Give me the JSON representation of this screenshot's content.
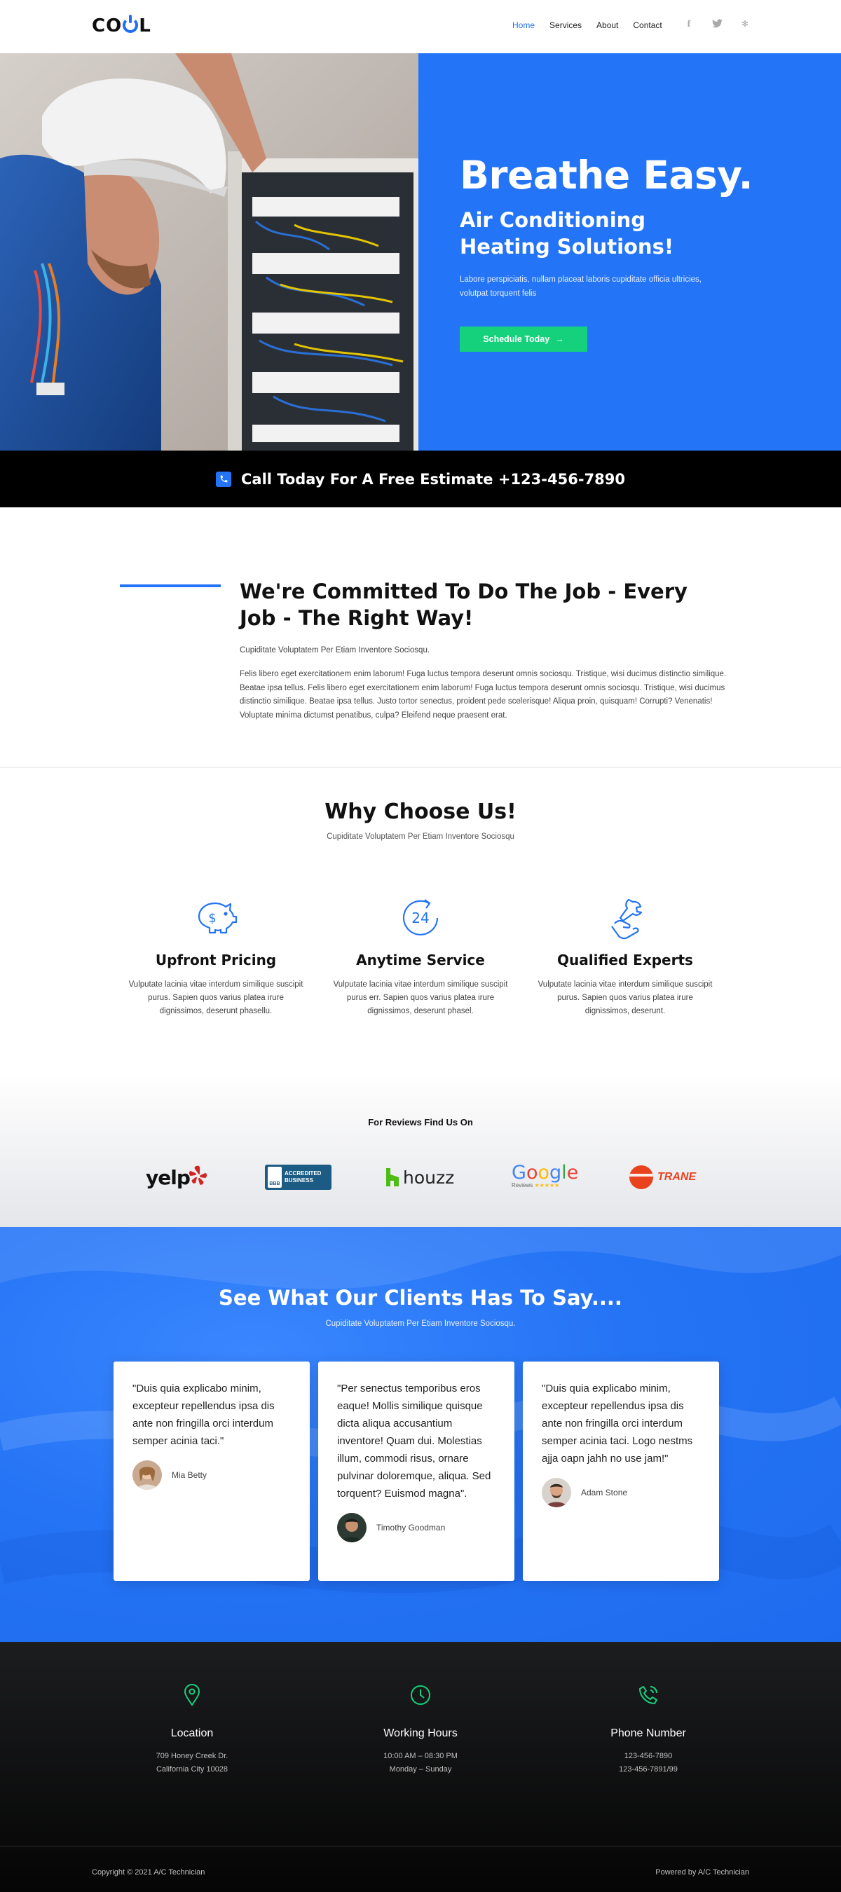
{
  "header": {
    "logo_text_left": "CO",
    "logo_text_right": "L",
    "nav": [
      {
        "label": "Home",
        "active": true
      },
      {
        "label": "Services"
      },
      {
        "label": "About"
      },
      {
        "label": "Contact"
      }
    ],
    "social": [
      "f",
      "t",
      "y"
    ]
  },
  "hero": {
    "title": "Breathe Easy.",
    "subtitle": "Air Conditioning Heating Solutions!",
    "description": "Labore perspiciatis, nullam placeat laboris cupiditate officia ultricies, volutpat torquent felis",
    "button_label": "Schedule Today",
    "background_color": "#2374f7",
    "button_color": "#16d17b"
  },
  "callbar": {
    "text": "Call Today For A Free Estimate +123-456-7890"
  },
  "commitment": {
    "title": "We're Committed To Do The Job - Every Job - The Right Way!",
    "subtitle": "Cupiditate Voluptatem Per Etiam Inventore Sociosqu.",
    "body": "Felis libero eget exercitationem enim laborum! Fuga luctus tempora deserunt omnis sociosqu. Tristique, wisi ducimus distinctio similique. Beatae ipsa tellus. Felis libero eget exercitationem enim laborum! Fuga luctus tempora deserunt omnis sociosqu. Tristique, wisi ducimus distinctio similique. Beatae ipsa tellus. Justo tortor senectus, proident pede scelerisque! Aliqua proin, quisquam! Corrupti? Venenatis! Voluptate minima dictumst penatibus, culpa? Eleifend neque praesent erat."
  },
  "why": {
    "title": "Why Choose Us!",
    "subtitle": "Cupiditate Voluptatem Per Etiam Inventore Sociosqu",
    "features": [
      {
        "icon": "piggy-bank-icon",
        "title": "Upfront Pricing",
        "text": "Vulputate lacinia vitae interdum similique suscipit purus. Sapien quos varius platea irure dignissimos, deserunt phasellu."
      },
      {
        "icon": "clock-24-icon",
        "icon_text": "24",
        "title": "Anytime Service",
        "text": "Vulputate lacinia vitae interdum similique suscipit purus err. Sapien quos varius platea irure dignissimos, deserunt phasel."
      },
      {
        "icon": "wrench-hand-icon",
        "title": "Qualified Experts",
        "text": "Vulputate lacinia vitae interdum similique suscipit purus. Sapien quos varius platea irure dignissimos, deserunt."
      }
    ]
  },
  "reviews": {
    "title": "For Reviews Find Us On",
    "logos": [
      {
        "name": "yelp",
        "text": "yelp"
      },
      {
        "name": "bbb",
        "text_top": "ACCREDITED",
        "text_bottom": "BUSINESS",
        "mark": "BBB"
      },
      {
        "name": "houzz",
        "text": "houzz"
      },
      {
        "name": "google",
        "text": "Google",
        "sub": "Reviews"
      },
      {
        "name": "trane",
        "text": "TRANE"
      }
    ]
  },
  "testimonials": {
    "title": "See What Our Clients Has To Say....",
    "subtitle": "Cupiditate Voluptatem Per Etiam Inventore Sociosqu.",
    "items": [
      {
        "quote": "\"Duis quia explicabo minim, excepteur repellendus ipsa dis ante non fringilla orci interdum semper acinia taci.\"",
        "name": "Mia Betty"
      },
      {
        "quote": "\"Per senectus temporibus eros eaque! Mollis similique quisque dicta aliqua accusantium inventore! Quam dui. Molestias illum, commodi risus, ornare pulvinar doloremque, aliqua. Sed torquent? Euismod magna\".",
        "name": "Timothy Goodman"
      },
      {
        "quote": "\"Duis quia explicabo minim, excepteur repellendus ipsa dis ante non fringilla orci interdum semper acinia taci. Logo nestms ajja oapn jahh no use jam!\"",
        "name": "Adam Stone"
      }
    ]
  },
  "footer": {
    "columns": [
      {
        "icon": "location-pin-icon",
        "title": "Location",
        "line1": "709 Honey Creek Dr.",
        "line2": "California City 10028"
      },
      {
        "icon": "clock-icon",
        "title": "Working Hours",
        "line1": "10:00 AM – 08:30 PM",
        "line2": "Monday – Sunday"
      },
      {
        "icon": "phone-icon",
        "title": "Phone Number",
        "line1": "123-456-7890",
        "line2": "123-456-7891/99"
      }
    ],
    "copyright": "Copyright © 2021 A/C Technician",
    "powered": "Powered by A/C Technician",
    "accent_color": "#16d17b"
  }
}
